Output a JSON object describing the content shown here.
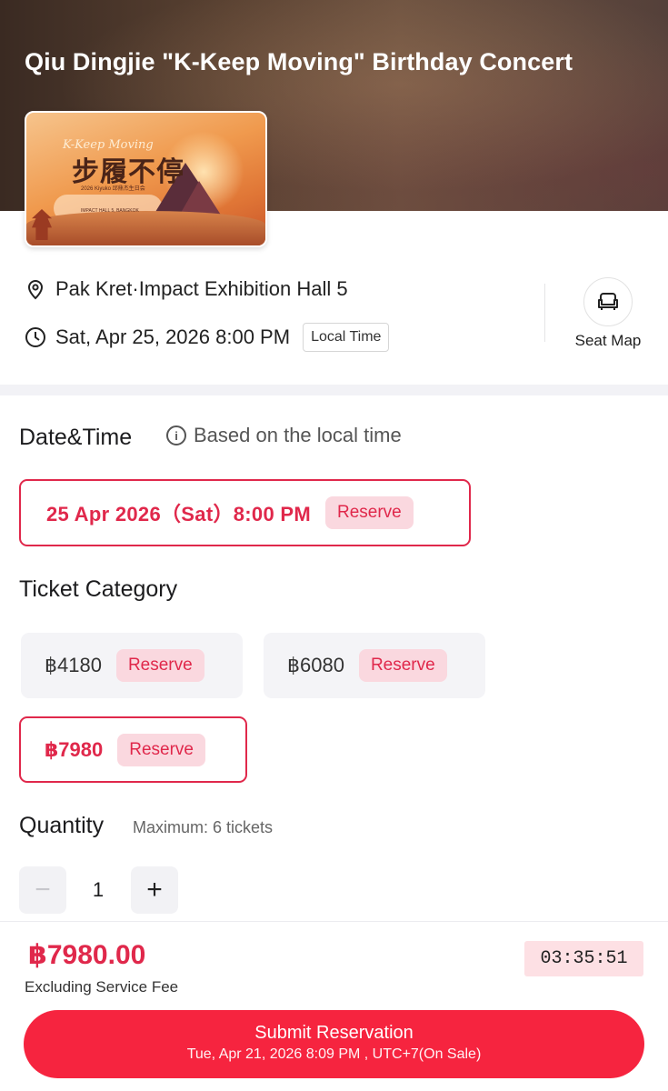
{
  "event": {
    "title": "Qiu Dingjie \"K-Keep Moving\" Birthday Concert",
    "poster": {
      "english_title": "K-Keep Moving",
      "chinese_title": "步履不停",
      "subtitle": "2026 Kiyuko 邱鼎杰生日会",
      "venue_line": "IMPACT HALL 5, BANGKOK"
    }
  },
  "info": {
    "location_icon": "location-pin-icon",
    "location": "Pak Kret·Impact Exhibition Hall 5",
    "clock_icon": "clock-icon",
    "datetime": "Sat, Apr 25, 2026 8:00 PM",
    "local_time_badge": "Local Time",
    "seat_map_icon": "armchair-icon",
    "seat_map_label": "Seat Map"
  },
  "date_section": {
    "title": "Date&Time",
    "hint_icon": "info-icon",
    "hint": "Based on the local time",
    "option": {
      "label": "25 Apr 2026（Sat）8:00 PM",
      "reserve": "Reserve",
      "selected": true
    }
  },
  "ticket_section": {
    "title": "Ticket Category",
    "tickets": [
      {
        "price": "฿4180",
        "reserve": "Reserve",
        "selected": false
      },
      {
        "price": "฿6080",
        "reserve": "Reserve",
        "selected": false
      },
      {
        "price": "฿7980",
        "reserve": "Reserve",
        "selected": true
      }
    ]
  },
  "quantity_section": {
    "title": "Quantity",
    "maximum": "Maximum: 6 tickets",
    "minus": "−",
    "value": "1",
    "plus": "+"
  },
  "footer": {
    "total": "฿7980.00",
    "fee_note": "Excluding Service Fee",
    "countdown": "03:35:51",
    "submit_label": "Submit Reservation",
    "submit_sub": "Tue, Apr 21, 2026 8:09 PM , UTC+7(On Sale)"
  },
  "colors": {
    "accent": "#e0284b",
    "submit": "#f6243f",
    "reserve_bg": "#fad8df"
  }
}
